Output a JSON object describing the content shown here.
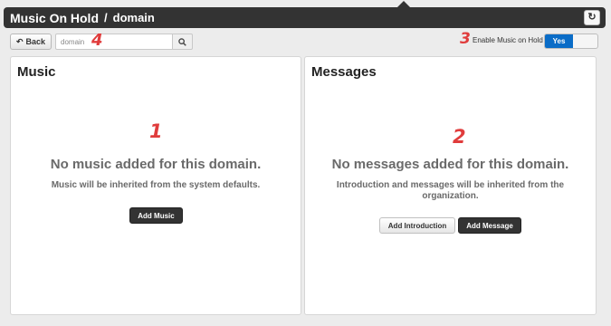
{
  "header": {
    "title": "Music On Hold",
    "separator": "/",
    "subtitle": "domain"
  },
  "toolbar": {
    "back_label": "Back",
    "search_value": "domain",
    "moh_label": "Enable Music on Hold",
    "toggle_value": "Yes"
  },
  "annotations": {
    "n1": "1",
    "n2": "2",
    "n3": "3",
    "n4": "4"
  },
  "music": {
    "title": "Music",
    "empty_title": "No music added for this domain.",
    "empty_sub": "Music will be inherited from the system defaults.",
    "add_label": "Add Music"
  },
  "messages": {
    "title": "Messages",
    "empty_title": "No messages added for this domain.",
    "empty_sub": "Introduction and messages will be inherited from the organization.",
    "add_intro_label": "Add Introduction",
    "add_message_label": "Add Message"
  },
  "colors": {
    "titlebar": "#333333",
    "toggle_active": "#0a6cc7",
    "annotation": "#e03c3c"
  },
  "icons": {
    "refresh": "refresh-icon",
    "back": "back-arrow-icon",
    "search": "search-icon"
  }
}
